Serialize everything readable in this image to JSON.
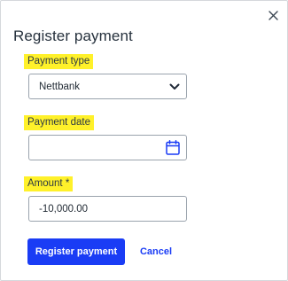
{
  "dialog": {
    "title": "Register payment",
    "close_icon": "close-icon"
  },
  "payment_type": {
    "label": "Payment type",
    "value": "Nettbank",
    "icon": "chevron-down-icon"
  },
  "payment_date": {
    "label": "Payment date",
    "value": "",
    "icon": "calendar-icon"
  },
  "amount": {
    "label": "Amount *",
    "value": "-10,000.00"
  },
  "actions": {
    "primary_label": "Register payment",
    "secondary_label": "Cancel"
  },
  "colors": {
    "highlight": "#fff12a",
    "accent": "#1a3cf5",
    "border": "#9aa3ad"
  }
}
